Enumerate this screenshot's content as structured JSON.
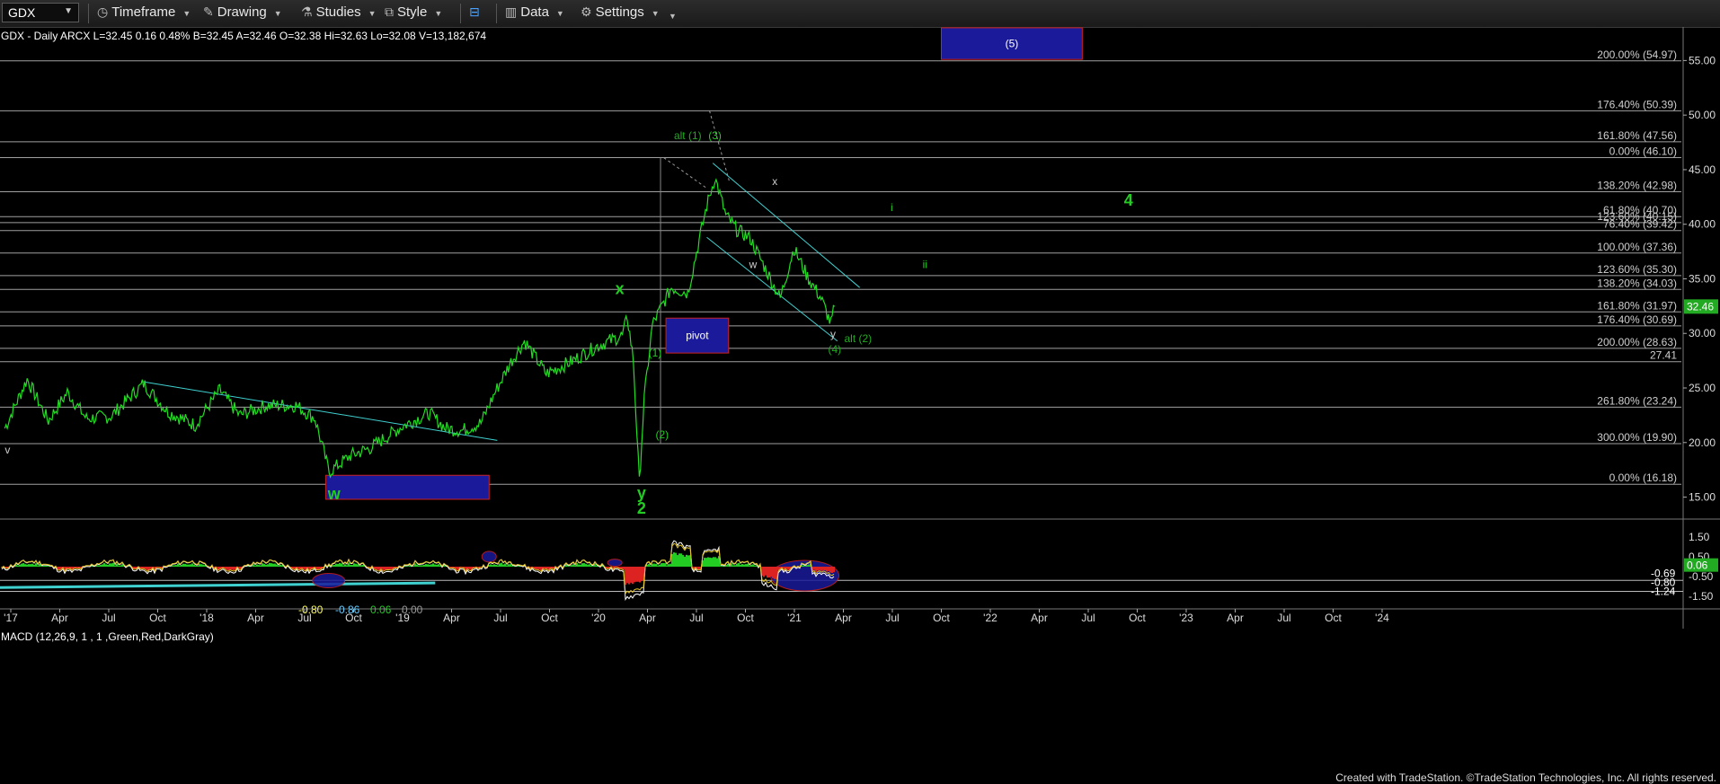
{
  "toolbar": {
    "symbol": "GDX",
    "timeframe": "Timeframe",
    "drawing": "Drawing",
    "studies": "Studies",
    "style": "Style",
    "data": "Data",
    "settings": "Settings"
  },
  "chart_data": {
    "type": "line",
    "header": "GDX - Daily  ARCX L=32.45  0.16  0.48%  B=32.45  A=32.46  O=32.38  Hi=32.63  Lo=32.08  V=13,182,674",
    "last_price": "32.46",
    "price_axis": {
      "ylim": [
        13.4,
        57.5
      ],
      "ticks": [
        "55.00",
        "50.00",
        "45.00",
        "40.00",
        "35.00",
        "30.00",
        "25.00",
        "20.00",
        "15.00"
      ],
      "tick_values": [
        55,
        50,
        45,
        40,
        35,
        30,
        25,
        20,
        15
      ]
    },
    "time_axis": {
      "labels": [
        "'17",
        "Apr",
        "Jul",
        "Oct",
        "'18",
        "Apr",
        "Jul",
        "Oct",
        "'19",
        "Apr",
        "Jul",
        "Oct",
        "'20",
        "Apr",
        "Jul",
        "Oct",
        "'21",
        "Apr",
        "Jul",
        "Oct",
        "'22",
        "Apr",
        "Jul",
        "Oct",
        "'23",
        "Apr",
        "Jul",
        "Oct",
        "'24"
      ],
      "start": "2017-01",
      "step_months": 3
    },
    "series": [
      {
        "color": "#22dd22",
        "points": [
          [
            "2016-12-20",
            21.3
          ],
          [
            "2017-02-01",
            25.8
          ],
          [
            "2017-03-10",
            22.0
          ],
          [
            "2017-04-15",
            24.6
          ],
          [
            "2017-05-20",
            22.2
          ],
          [
            "2017-07-05",
            22.4
          ],
          [
            "2017-09-05",
            25.4
          ],
          [
            "2017-10-20",
            22.8
          ],
          [
            "2017-12-10",
            21.6
          ],
          [
            "2018-01-25",
            24.8
          ],
          [
            "2018-03-01",
            22.5
          ],
          [
            "2018-04-20",
            23.4
          ],
          [
            "2018-06-15",
            23.4
          ],
          [
            "2018-07-20",
            22.2
          ],
          [
            "2018-08-16",
            17.3
          ],
          [
            "2018-09-25",
            18.8
          ],
          [
            "2018-11-01",
            19.5
          ],
          [
            "2019-01-01",
            21.5
          ],
          [
            "2019-02-20",
            22.7
          ],
          [
            "2019-03-20",
            21.3
          ],
          [
            "2019-04-20",
            21.1
          ],
          [
            "2019-05-25",
            21.8
          ],
          [
            "2019-06-20",
            24.5
          ],
          [
            "2019-07-20",
            27.4
          ],
          [
            "2019-08-15",
            29.3
          ],
          [
            "2019-09-25",
            26.3
          ],
          [
            "2019-11-10",
            27.4
          ],
          [
            "2019-12-31",
            28.9
          ],
          [
            "2020-02-15",
            29.8
          ],
          [
            "2020-02-24",
            31.5
          ],
          [
            "2020-03-05",
            27.6
          ],
          [
            "2020-03-16",
            16.3
          ],
          [
            "2020-03-25",
            24.0
          ],
          [
            "2020-04-10",
            30.8
          ],
          [
            "2020-05-15",
            34.2
          ],
          [
            "2020-06-15",
            33.7
          ],
          [
            "2020-07-20",
            41.7
          ],
          [
            "2020-08-05",
            44.3
          ],
          [
            "2020-08-25",
            40.8
          ],
          [
            "2020-09-15",
            39.5
          ],
          [
            "2020-10-10",
            38.7
          ],
          [
            "2020-11-10",
            35.7
          ],
          [
            "2020-12-05",
            33.2
          ],
          [
            "2020-12-30",
            37.8
          ],
          [
            "2021-01-25",
            35.2
          ],
          [
            "2021-02-20",
            33.2
          ],
          [
            "2021-03-08",
            30.9
          ],
          [
            "2021-03-15",
            32.46
          ]
        ]
      }
    ],
    "fib_levels": [
      {
        "label": "200.00% (54.97)",
        "value": 54.97
      },
      {
        "label": "176.40% (50.39)",
        "value": 50.39
      },
      {
        "label": "161.80% (47.56)",
        "value": 47.56
      },
      {
        "label": "0.00% (46.10)",
        "value": 46.1
      },
      {
        "label": "138.20% (42.98)",
        "value": 42.98
      },
      {
        "label": "61.80% (40.70)",
        "value": 40.7
      },
      {
        "label": "123.60% (40.15)",
        "value": 40.15
      },
      {
        "label": "76.40% (39.42)",
        "value": 39.42
      },
      {
        "label": "100.00% (37.36)",
        "value": 37.36
      },
      {
        "label": "123.60% (35.30)",
        "value": 35.3
      },
      {
        "label": "138.20% (34.03)",
        "value": 34.03
      },
      {
        "label": "161.80% (31.97)",
        "value": 31.97
      },
      {
        "label": "176.40% (30.69)",
        "value": 30.69
      },
      {
        "label": "200.00% (28.63)",
        "value": 28.63
      },
      {
        "label": "27.41",
        "value": 27.41
      },
      {
        "label": "261.80% (23.24)",
        "value": 23.24
      },
      {
        "label": "300.00% (19.90)",
        "value": 19.9
      },
      {
        "label": "0.00% (16.18)",
        "value": 16.18
      }
    ],
    "wave_labels": [
      {
        "text": "w",
        "date": "2018-08-25",
        "price": 14.8,
        "color": "#22cc22"
      },
      {
        "text": "x",
        "date": "2020-02-10",
        "price": 33.6,
        "color": "#22cc22"
      },
      {
        "text": "y",
        "date": "2020-03-20",
        "price": 14.9,
        "color": "#22cc22"
      },
      {
        "text": "2",
        "date": "2020-03-20",
        "price": 13.5,
        "color": "#22cc22"
      },
      {
        "text": "(1)",
        "date": "2020-04-15",
        "price": 27.9,
        "color": "#22cc22"
      },
      {
        "text": "(2)",
        "date": "2020-04-28",
        "price": 20.4,
        "color": "#22cc22"
      },
      {
        "text": "alt (1)",
        "date": "2020-06-15",
        "price": 47.8,
        "color": "#22aa22"
      },
      {
        "text": "(3)",
        "date": "2020-08-05",
        "price": 47.8,
        "color": "#22cc22"
      },
      {
        "text": "x",
        "date": "2020-11-25",
        "price": 43.6,
        "color": "#cccccc"
      },
      {
        "text": "w",
        "date": "2020-10-15",
        "price": 36.0,
        "color": "#cccccc"
      },
      {
        "text": "y",
        "date": "2021-03-12",
        "price": 29.6,
        "color": "#cccccc"
      },
      {
        "text": "alt (2)",
        "date": "2021-04-28",
        "price": 29.2,
        "color": "#22aa22"
      },
      {
        "text": "(4)",
        "date": "2021-03-15",
        "price": 28.2,
        "color": "#22aa22"
      },
      {
        "text": "i",
        "date": "2021-06-30",
        "price": 41.2,
        "color": "#22cc22"
      },
      {
        "text": "ii",
        "date": "2021-09-01",
        "price": 36.0,
        "color": "#22cc22"
      },
      {
        "text": "4",
        "date": "2022-09-15",
        "price": 41.7,
        "color": "#22cc22"
      },
      {
        "text": "v",
        "date": "2016-12-25",
        "price": 19.0,
        "color": "#cccccc"
      }
    ],
    "boxes": [
      {
        "label": "",
        "from": "2018-08-10",
        "to": "2019-06-10",
        "top": 17.0,
        "bottom": 14.8
      },
      {
        "label": "pivot",
        "from": "2020-05-05",
        "to": "2020-08-30",
        "top": 31.4,
        "bottom": 28.2
      },
      {
        "label": "(5)",
        "from": "2021-10-01",
        "to": "2022-06-20",
        "top": 58.0,
        "bottom": 55.1
      }
    ],
    "macd": {
      "title": "MACD (12,26,9, 1 , 1 ,Green,Red,DarkGray)",
      "values": [
        "-0.80",
        "-0.86",
        "0.06",
        "0.00"
      ],
      "ticks": [
        "1.50",
        "0.50",
        "-0.50",
        "-1.50"
      ],
      "tick_values": [
        1.5,
        0.5,
        -0.5,
        -1.5
      ],
      "ylim": [
        -1.85,
        1.85
      ],
      "current_labels": [
        "-0.69",
        "-0.80",
        "-1.24",
        "0.06"
      ]
    },
    "footer": "Created with TradeStation. ©TradeStation Technologies, Inc. All rights reserved."
  }
}
